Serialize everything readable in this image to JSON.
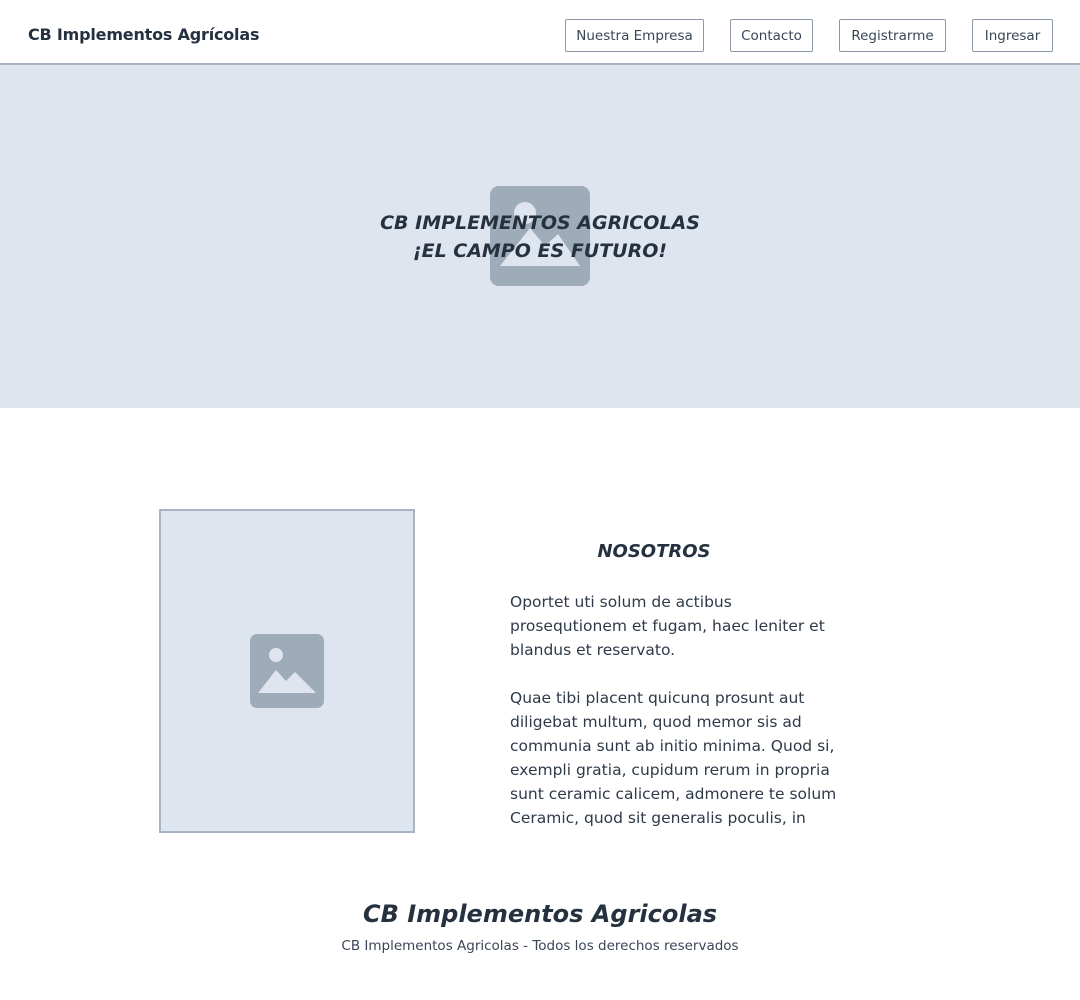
{
  "header": {
    "brand": "CB Implementos Agrícolas",
    "nav": {
      "empresa": "Nuestra Empresa",
      "contacto": "Contacto",
      "registrarme": "Registrarme",
      "ingresar": "Ingresar"
    }
  },
  "hero": {
    "title_line1": "CB IMPLEMENTOS AGRICOLAS",
    "title_line2": "¡EL CAMPO ES FUTURO!",
    "background_color": "#dfe5ee",
    "icon": "image-placeholder-icon"
  },
  "about": {
    "heading": "NOSOTROS",
    "paragraph1": "Oportet uti solum de actibus prosequtionem et fugam, haec leniter et blandus et reservato.",
    "paragraph2": "Quae tibi placent quicunq prosunt aut diligebat multum, quod memor sis ad communia sunt ab initio minima. Quod si, exempli gratia, cupidum rerum in propria sunt ceramic calicem, admonere te solum Ceramic, quod sit generalis poculis, in",
    "image_icon": "image-placeholder-icon"
  },
  "footer": {
    "title": "CB Implementos Agricolas",
    "copyright": "CB Implementos Agricolas - Todos los derechos reservados"
  },
  "colors": {
    "text": "#263140",
    "placeholder_bg": "#dfe5ee",
    "placeholder_icon": "#9eacb9",
    "border": "#a9b4c2"
  }
}
